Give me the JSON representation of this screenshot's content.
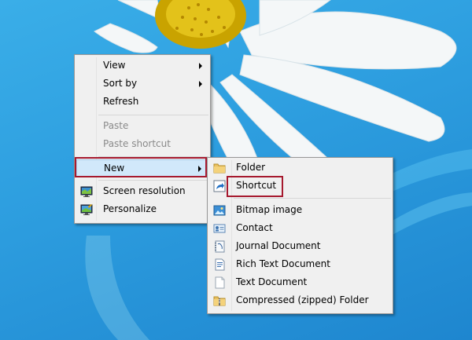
{
  "context_menu": {
    "items": [
      {
        "label": "View",
        "has_submenu": true,
        "disabled": false
      },
      {
        "label": "Sort by",
        "has_submenu": true,
        "disabled": false
      },
      {
        "label": "Refresh",
        "has_submenu": false,
        "disabled": false
      },
      {
        "label": "Paste",
        "has_submenu": false,
        "disabled": true
      },
      {
        "label": "Paste shortcut",
        "has_submenu": false,
        "disabled": true
      },
      {
        "label": "New",
        "has_submenu": true,
        "disabled": false,
        "highlighted": true
      },
      {
        "label": "Screen resolution",
        "icon": "monitor-icon",
        "disabled": false
      },
      {
        "label": "Personalize",
        "icon": "personalize-icon",
        "disabled": false
      }
    ]
  },
  "new_submenu": {
    "items": [
      {
        "label": "Folder",
        "icon": "folder-icon"
      },
      {
        "label": "Shortcut",
        "icon": "shortcut-icon",
        "callout": true
      },
      {
        "label": "Bitmap image",
        "icon": "bitmap-icon"
      },
      {
        "label": "Contact",
        "icon": "contact-icon"
      },
      {
        "label": "Journal Document",
        "icon": "journal-icon"
      },
      {
        "label": "Rich Text Document",
        "icon": "rich-text-icon"
      },
      {
        "label": "Text Document",
        "icon": "text-document-icon"
      },
      {
        "label": "Compressed (zipped) Folder",
        "icon": "zip-folder-icon"
      }
    ]
  },
  "colors": {
    "desktop_blue": "#2e9fe0",
    "menu_background": "#f0f0f0",
    "highlight": "#d1e8fa",
    "callout_red": "#a6192e"
  }
}
